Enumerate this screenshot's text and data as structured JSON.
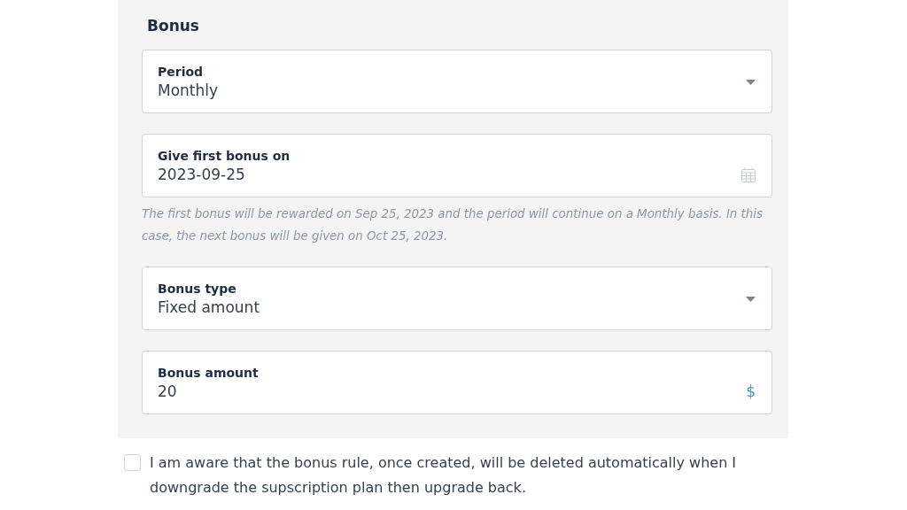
{
  "section": {
    "title": "Bonus"
  },
  "fields": [
    {
      "kind": "select",
      "label": "Period",
      "value": "Monthly"
    },
    {
      "kind": "date",
      "label": "Give first bonus on",
      "value": "2023-09-25",
      "hint": "The first bonus will be rewarded on Sep 25, 2023 and the period will continue on a Monthly basis. In this case, the next bonus will be given on Oct 25, 2023."
    },
    {
      "kind": "select",
      "label": "Bonus type",
      "value": "Fixed amount"
    },
    {
      "kind": "amount",
      "label": "Bonus amount",
      "value": "20",
      "suffix": "$"
    }
  ],
  "agreement": {
    "checked": false,
    "text": "I am aware that the bonus rule, once created, will be deleted automatically when I downgrade the supscription plan then upgrade back."
  }
}
